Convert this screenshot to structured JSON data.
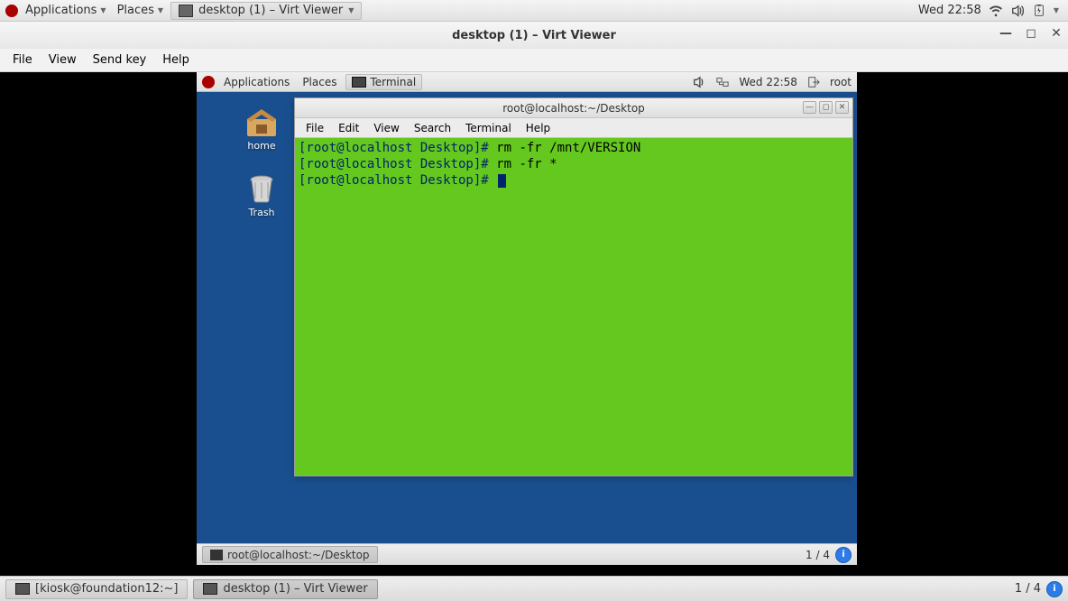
{
  "host": {
    "panel": {
      "applications": "Applications",
      "places": "Places",
      "running_task": "desktop (1) – Virt Viewer",
      "clock": "Wed 22:58"
    },
    "taskbar": {
      "task1": "[kiosk@foundation12:~]",
      "task2": "desktop (1) – Virt Viewer",
      "workspace": "1 / 4"
    }
  },
  "virtviewer": {
    "title": "desktop (1) – Virt Viewer",
    "menu": {
      "file": "File",
      "view": "View",
      "sendkey": "Send key",
      "help": "Help"
    }
  },
  "guest": {
    "panel": {
      "applications": "Applications",
      "places": "Places",
      "running": "Terminal",
      "clock": "Wed 22:58",
      "user": "root"
    },
    "icons": {
      "home": "home",
      "trash": "Trash"
    },
    "terminal": {
      "title": "root@localhost:~/Desktop",
      "menu": {
        "file": "File",
        "edit": "Edit",
        "view": "View",
        "search": "Search",
        "terminal": "Terminal",
        "help": "Help"
      },
      "lines": [
        {
          "prompt": "[root@localhost Desktop]# ",
          "cmd": "rm -fr /mnt/VERSION"
        },
        {
          "prompt": "[root@localhost Desktop]# ",
          "cmd": "rm -fr *"
        },
        {
          "prompt": "[root@localhost Desktop]# ",
          "cmd": ""
        }
      ]
    },
    "taskbar": {
      "task": "root@localhost:~/Desktop",
      "workspace": "1 / 4"
    }
  }
}
